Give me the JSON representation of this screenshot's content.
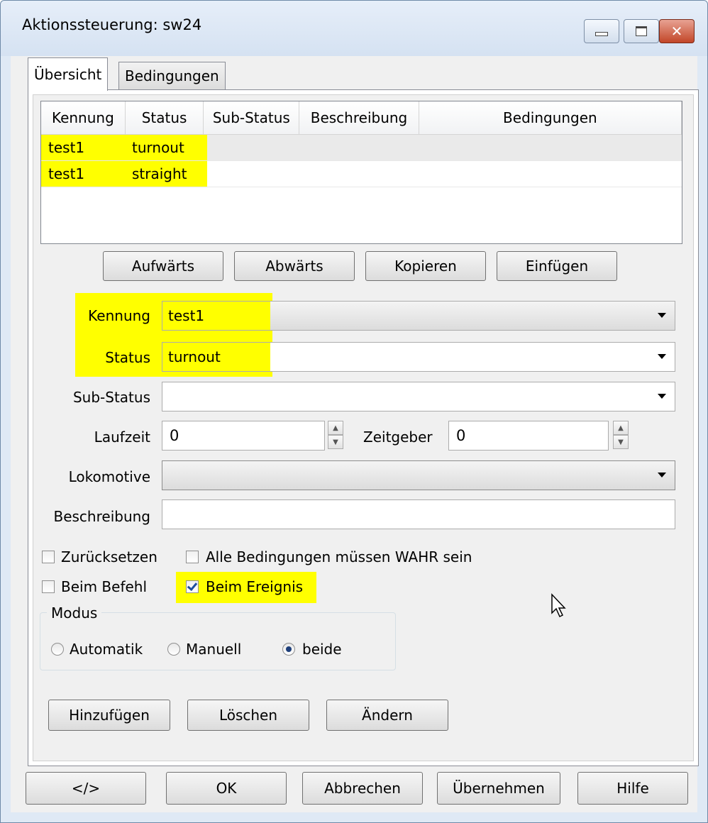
{
  "window": {
    "title": "Aktionssteuerung: sw24",
    "min_icon": "minimize-icon",
    "max_icon": "maximize-icon",
    "close_icon": "close-icon"
  },
  "tabs": [
    {
      "label": "Übersicht",
      "active": true
    },
    {
      "label": "Bedingungen",
      "active": false
    }
  ],
  "table": {
    "headers": [
      "Kennung",
      "Status",
      "Sub-Status",
      "Beschreibung",
      "Bedingungen"
    ],
    "rows": [
      {
        "kennung": "test1",
        "status": "turnout",
        "sub_status": "",
        "beschreibung": "",
        "bedingungen": ""
      },
      {
        "kennung": "test1",
        "status": "straight",
        "sub_status": "",
        "beschreibung": "",
        "bedingungen": ""
      }
    ]
  },
  "row_buttons": {
    "up": "Aufwärts",
    "down": "Abwärts",
    "copy": "Kopieren",
    "paste": "Einfügen"
  },
  "form": {
    "kennung_label": "Kennung",
    "kennung_value": "test1",
    "status_label": "Status",
    "status_value": "turnout",
    "substatus_label": "Sub-Status",
    "substatus_value": "",
    "laufzeit_label": "Laufzeit",
    "laufzeit_value": "0",
    "zeitgeber_label": "Zeitgeber",
    "zeitgeber_value": "0",
    "lok_label": "Lokomotive",
    "lok_value": "",
    "beschreibung_label": "Beschreibung",
    "beschreibung_value": ""
  },
  "checkboxes": {
    "reset": {
      "label": "Zurücksetzen",
      "checked": false
    },
    "all_true": {
      "label": "Alle Bedingungen müssen WAHR sein",
      "checked": false
    },
    "on_command": {
      "label": "Beim Befehl",
      "checked": false
    },
    "on_event": {
      "label": "Beim Ereignis",
      "checked": true
    }
  },
  "mode": {
    "title": "Modus",
    "options": [
      {
        "label": "Automatik",
        "selected": false
      },
      {
        "label": "Manuell",
        "selected": false
      },
      {
        "label": "beide",
        "selected": true
      }
    ]
  },
  "action_buttons": {
    "add": "Hinzufügen",
    "delete": "Löschen",
    "modify": "Ändern"
  },
  "footer": {
    "xml": "</>",
    "ok": "OK",
    "cancel": "Abbrechen",
    "apply": "Übernehmen",
    "help": "Hilfe"
  },
  "colors": {
    "highlight": "#ffff00",
    "title_bg": "#dce7f5",
    "close_button": "#c24628"
  }
}
